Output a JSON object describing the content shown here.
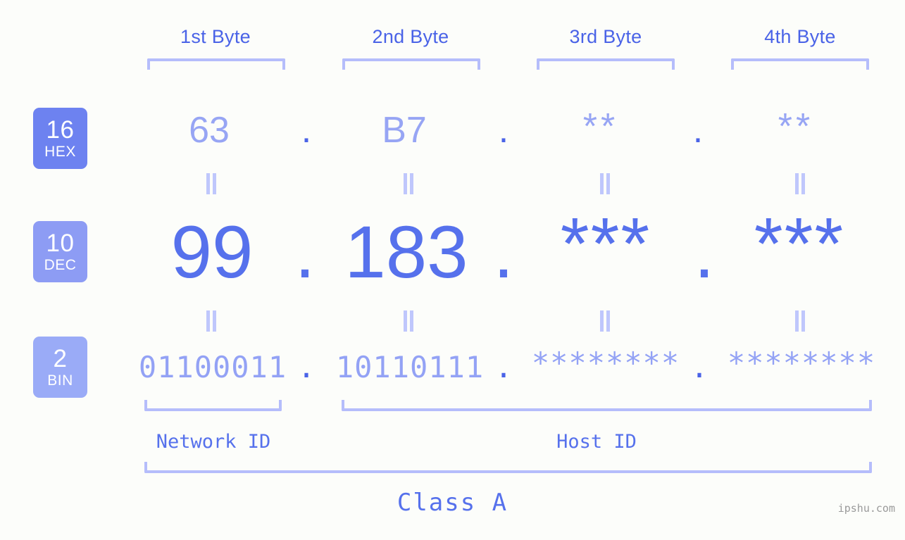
{
  "watermark": "ipshu.com",
  "class_label": "Class A",
  "byte_headers": [
    {
      "label": "1st Byte"
    },
    {
      "label": "2nd Byte"
    },
    {
      "label": "3rd Byte"
    },
    {
      "label": "4th Byte"
    }
  ],
  "bases": [
    {
      "num": "16",
      "name": "HEX",
      "color": "#6d82f0"
    },
    {
      "num": "10",
      "name": "DEC",
      "color": "#8d9cf4"
    },
    {
      "num": "2",
      "name": "BIN",
      "color": "#9aabf7"
    }
  ],
  "rows": {
    "hex": {
      "values": [
        "63",
        "B7",
        "**",
        "**"
      ],
      "separators": [
        ".",
        ".",
        "."
      ]
    },
    "dec": {
      "values": [
        "99",
        "183",
        "***",
        "***"
      ],
      "separators": [
        ".",
        ".",
        "."
      ]
    },
    "bin": {
      "values": [
        "01100011",
        "10110111",
        "********",
        "********"
      ],
      "separators": [
        ".",
        ".",
        "."
      ]
    }
  },
  "equality_symbol": "=",
  "id_labels": {
    "network": "Network ID",
    "host": "Host ID"
  },
  "colors": {
    "background": "#fcfdfa",
    "accent_strong": "#4a63e7",
    "accent_mid": "#5671ec",
    "accent_light": "#97a5f4",
    "bracket": "#b5bdfb",
    "equals": "#bfc7fc",
    "watermark": "#9a9a9a"
  }
}
